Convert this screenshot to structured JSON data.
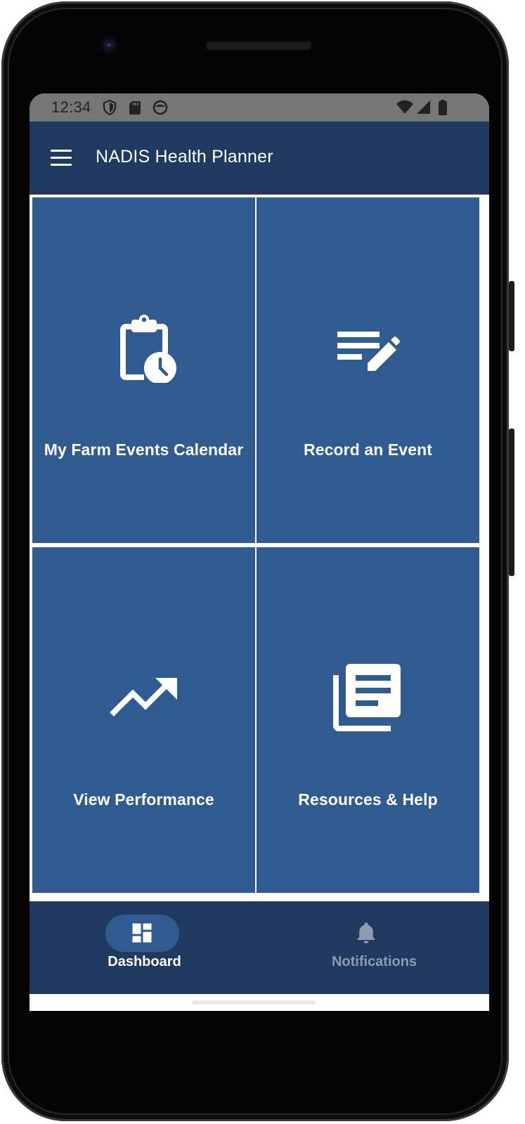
{
  "status_bar": {
    "time": "12:34",
    "icons": [
      "shield-icon",
      "sd-card-icon",
      "sync-circle-icon",
      "wifi-icon",
      "signal-icon",
      "battery-icon"
    ]
  },
  "app_bar": {
    "title": "NADIS Health Planner",
    "menu_icon": "hamburger-menu-icon"
  },
  "tiles": [
    {
      "label": "My Farm Events Calendar",
      "icon": "clipboard-clock-icon"
    },
    {
      "label": "Record an Event",
      "icon": "edit-note-icon"
    },
    {
      "label": "View Performance",
      "icon": "trending-up-icon"
    },
    {
      "label": "Resources & Help",
      "icon": "library-books-icon"
    }
  ],
  "bottom_nav": {
    "items": [
      {
        "label": "Dashboard",
        "icon": "dashboard-icon",
        "active": true
      },
      {
        "label": "Notifications",
        "icon": "bell-icon",
        "active": false
      }
    ]
  },
  "colors": {
    "primary_dark": "#1f3a5e",
    "tile_blue": "#2f5b90",
    "status_bar": "#767676",
    "inactive_nav": "#8e9bb0"
  }
}
